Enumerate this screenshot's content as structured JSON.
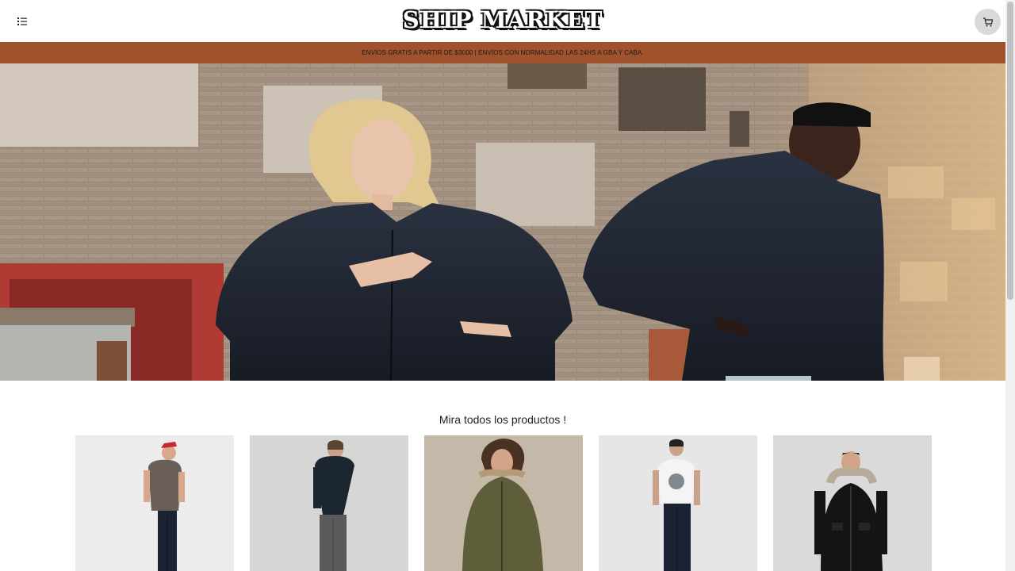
{
  "header": {
    "menu_icon": "list-icon",
    "logo": "SHIP MARKET",
    "cart_icon": "cart-icon"
  },
  "promo": {
    "text": "ENVÍOS GRATIS A PARTIR DE $3000 | ENVÍOS CON NORMALIDAD LAS 24HS A GBA Y CABA."
  },
  "products_section": {
    "title": "Mira todos los productos !"
  },
  "colors": {
    "promo_bar": "#a0522d",
    "cart_button_bg": "#d9d9d9"
  }
}
